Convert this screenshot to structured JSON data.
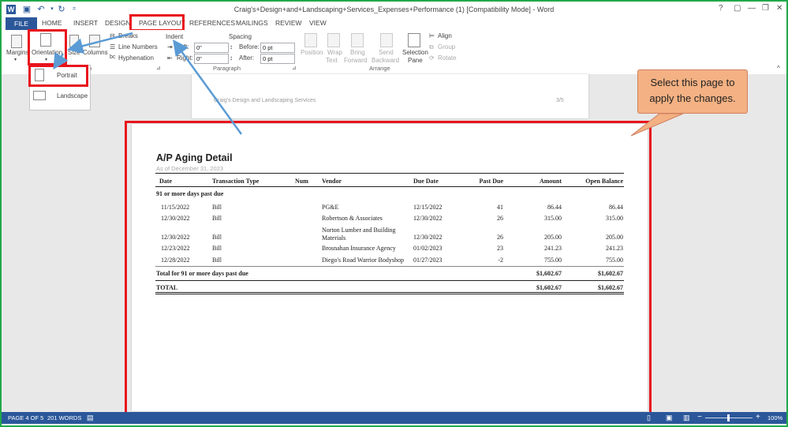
{
  "titlebar": {
    "title": "Craig's+Design+and+Landscaping+Services_Expenses+Performance (1) [Compatibility Mode] - Word",
    "help": "?",
    "window_controls": [
      "▢",
      "—",
      "❐",
      "✕"
    ]
  },
  "tabs": [
    "FILE",
    "HOME",
    "INSERT",
    "DESIGN",
    "PAGE LAYOUT",
    "REFERENCES",
    "MAILINGS",
    "REVIEW",
    "VIEW"
  ],
  "ribbon": {
    "margins": "Margins",
    "orientation": "Orientation",
    "size": "Size",
    "columns": "Columns",
    "breaks": "Breaks",
    "line_numbers": "Line Numbers",
    "hyphenation": "Hyphenation",
    "indent": "Indent",
    "left": "Left:",
    "right": "Right:",
    "left_val": "0\"",
    "right_val": "0\"",
    "spacing": "Spacing",
    "before": "Before:",
    "after": "After:",
    "before_val": "0 pt",
    "after_val": "0 pt",
    "position": "Position",
    "wrap_text": [
      "Wrap",
      "Text"
    ],
    "bring_forward": [
      "Bring",
      "Forward"
    ],
    "send_backward": [
      "Send",
      "Backward"
    ],
    "selection_pane": [
      "Selection",
      "Pane"
    ],
    "align": "Align",
    "group": "Group",
    "rotate": "Rotate",
    "group_page_setup": "p",
    "group_paragraph": "Paragraph",
    "group_arrange": "Arrange"
  },
  "dropdown": {
    "portrait": "Portrait",
    "landscape": "Landscape"
  },
  "prev_page": {
    "left": "Craig's Design and Landscaping Services",
    "right": "3/5"
  },
  "callout": "Select this page to apply the changes.",
  "report": {
    "title": "A/P Aging Detail",
    "subtitle": "As of December 31, 2023",
    "columns": [
      "Date",
      "Transaction Type",
      "Num",
      "Vendor",
      "Due Date",
      "Past Due",
      "Amount",
      "Open Balance"
    ],
    "section": "91 or more days past due",
    "rows": [
      {
        "date": "11/15/2022",
        "type": "Bill",
        "num": "",
        "vendor": "PG&E",
        "due": "12/15/2022",
        "past": "41",
        "amount": "86.44",
        "open": "86.44"
      },
      {
        "date": "12/30/2022",
        "type": "Bill",
        "num": "",
        "vendor": "Robertson & Associates",
        "due": "12/30/2022",
        "past": "26",
        "amount": "315.00",
        "open": "315.00"
      },
      {
        "date": "12/30/2022",
        "type": "Bill",
        "num": "",
        "vendor": "Norton Lumber and Building Materials",
        "due": "12/30/2022",
        "past": "26",
        "amount": "205.00",
        "open": "205.00"
      },
      {
        "date": "12/23/2022",
        "type": "Bill",
        "num": "",
        "vendor": "Brosnahan Insurance Agency",
        "due": "01/02/2023",
        "past": "23",
        "amount": "241.23",
        "open": "241.23"
      },
      {
        "date": "12/28/2022",
        "type": "Bill",
        "num": "",
        "vendor": "Diego's Road Warrior Bodyshop",
        "due": "01/27/2023",
        "past": "-2",
        "amount": "755.00",
        "open": "755.00"
      }
    ],
    "section_total_label": "Total for 91 or more days past due",
    "section_total_amount": "$1,602.67",
    "section_total_open": "$1,602.67",
    "total_label": "TOTAL",
    "total_amount": "$1,602.67",
    "total_open": "$1,602.67"
  },
  "status": {
    "page": "PAGE 4 OF 5",
    "words": "201 WORDS",
    "zoom": "100%",
    "minus": "−",
    "plus": "+"
  },
  "colors": {
    "accent": "#2b579a",
    "highlight": "#e8141c",
    "callout": "#f4b183",
    "frame": "#22a84a"
  }
}
